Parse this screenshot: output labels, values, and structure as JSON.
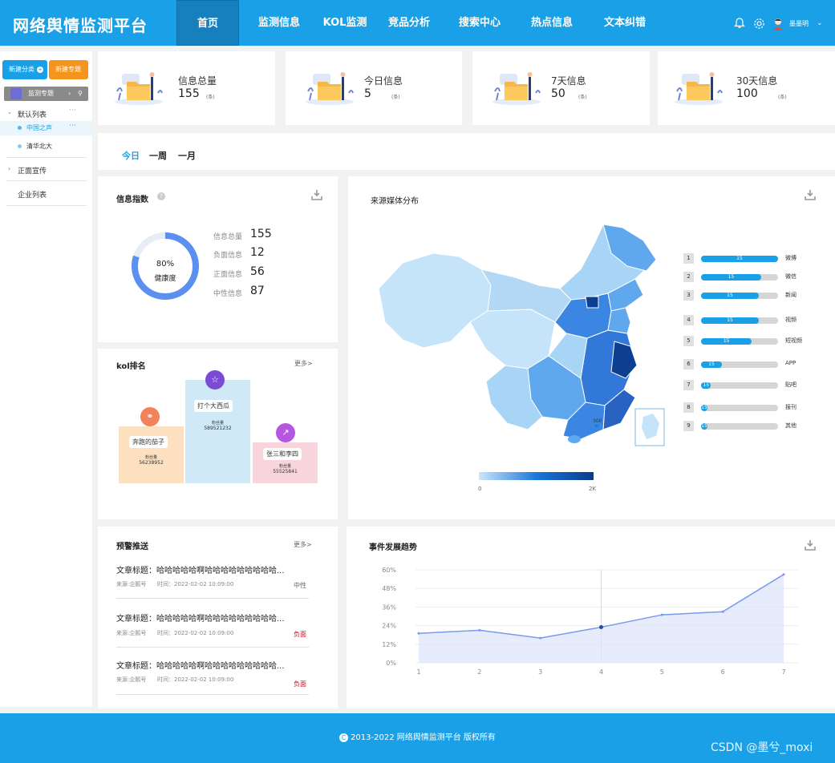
{
  "header": {
    "title": "网络舆情监测平台",
    "nav": [
      "首页",
      "监测信息",
      "KOL监测",
      "竞品分析",
      "搜索中心",
      "热点信息",
      "文本纠错"
    ],
    "username": "墨墨明",
    "accent": "#1aa0e6"
  },
  "sidebar": {
    "btn_category": "新建分类",
    "btn_topic": "新建专题",
    "monitor_label": "监测专题",
    "groups": [
      {
        "label": "默认列表",
        "items": [
          "中国之声",
          "清华北大"
        ]
      },
      {
        "label": "正面宣传"
      },
      {
        "label": "企业列表"
      }
    ]
  },
  "stats": [
    {
      "title": "信息总量",
      "value": "155",
      "unit": "(条)"
    },
    {
      "title": "今日信息",
      "value": "5",
      "unit": "(条)"
    },
    {
      "title": "7天信息",
      "value": "50",
      "unit": "(条)"
    },
    {
      "title": "30天信息",
      "value": "100",
      "unit": "(条)"
    }
  ],
  "tabs": [
    "今日",
    "一周",
    "一月"
  ],
  "index": {
    "title": "信息指数",
    "percent": "80%",
    "health": "健康度",
    "rows": [
      {
        "label": "信息总量",
        "value": "155"
      },
      {
        "label": "负面信息",
        "value": "12"
      },
      {
        "label": "正面信息",
        "value": "56"
      },
      {
        "label": "中性信息",
        "value": "87"
      }
    ]
  },
  "kol": {
    "title": "kol排名",
    "more": "更多>",
    "fans_label": "粉丝量",
    "items": [
      {
        "name": "奔跑的茄子",
        "fans": "56238952",
        "color": "#fde0bf",
        "icon_color": "#f2825a"
      },
      {
        "name": "打个大西瓜",
        "fans": "589521232",
        "color": "#cfe9f6",
        "icon_color": "#7a4bd4"
      },
      {
        "name": "张三和李四",
        "fans": "55525841",
        "color": "#f8d5dc",
        "icon_color": "#b557e0"
      }
    ]
  },
  "media": {
    "title": "来源媒体分布",
    "map_label": "300",
    "legend_min": "0",
    "legend_max": "2K",
    "ranks": [
      {
        "no": "1",
        "label": "微博",
        "value": "15",
        "pct": 1.0
      },
      {
        "no": "2",
        "label": "微信",
        "value": "15",
        "pct": 0.78
      },
      {
        "no": "3",
        "label": "新闻",
        "value": "15",
        "pct": 0.75
      },
      {
        "no": "4",
        "label": "视频",
        "value": "15",
        "pct": 0.75
      },
      {
        "no": "5",
        "label": "短视频",
        "value": "15",
        "pct": 0.66
      },
      {
        "no": "6",
        "label": "APP",
        "value": "15",
        "pct": 0.27
      },
      {
        "no": "7",
        "label": "贴吧",
        "value": "15",
        "pct": 0.13
      },
      {
        "no": "8",
        "label": "报刊",
        "value": "15",
        "pct": 0.06
      },
      {
        "no": "9",
        "label": "其他",
        "value": "15",
        "pct": 0.06
      }
    ]
  },
  "warning": {
    "title": "预警推送",
    "more": "更多>",
    "items": [
      {
        "title": "文章标题：哈哈哈哈哈啊哈哈哈哈哈哈哈哈哈...",
        "source": "来源:企鹅号",
        "time": "时间：2022-02-02 10:09:00",
        "sentiment": "中性",
        "color": "#666666"
      },
      {
        "title": "文章标题：哈哈哈哈哈啊哈哈哈哈哈哈哈哈哈...",
        "source": "来源:企鹅号",
        "time": "时间：2022-02-02 10:09:00",
        "sentiment": "负面",
        "color": "#d0021b"
      },
      {
        "title": "文章标题：哈哈哈哈哈啊哈哈哈哈哈哈哈哈哈...",
        "source": "来源:企鹅号",
        "time": "时间：2022-02-02 10:09:00",
        "sentiment": "负面",
        "color": "#d0021b"
      }
    ]
  },
  "trend": {
    "title": "事件发展趋势"
  },
  "chart_data": {
    "type": "area",
    "title": "事件发展趋势",
    "x": [
      "1",
      "2",
      "3",
      "4",
      "5",
      "6",
      "7"
    ],
    "series": [
      {
        "values": [
          19,
          21,
          16,
          23,
          31,
          33,
          57
        ]
      }
    ],
    "yticks": [
      "0%",
      "12%",
      "24%",
      "36%",
      "48%",
      "60%"
    ],
    "ylim": [
      0,
      60
    ],
    "grid": true,
    "color": "#7a9af0"
  },
  "footer": {
    "copyright": "2013-2022 网络舆情监测平台 版权所有",
    "watermark": "CSDN @墨兮_moxi"
  }
}
